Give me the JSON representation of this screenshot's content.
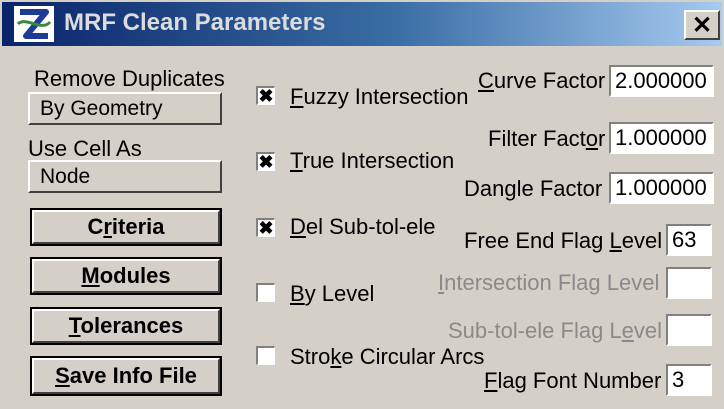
{
  "window": {
    "title": "MRF Clean Parameters",
    "close_label": "✕"
  },
  "left": {
    "remove_duplicates_label": "Remove Duplicates",
    "remove_duplicates_value": "By Geometry",
    "use_cell_label": "Use Cell As",
    "use_cell_value": "Node",
    "buttons": {
      "criteria": {
        "pre": "C",
        "ul": "r",
        "post": "iteria"
      },
      "modules": {
        "pre": "",
        "ul": "M",
        "post": "odules"
      },
      "tolerances": {
        "pre": "",
        "ul": "T",
        "post": "olerances"
      },
      "save_info": {
        "pre": "",
        "ul": "S",
        "post": "ave Info File"
      }
    }
  },
  "checkboxes": [
    {
      "pre": "",
      "ul": "F",
      "post": "uzzy Intersection",
      "checked": true,
      "mark": "✖"
    },
    {
      "pre": "",
      "ul": "T",
      "post": "rue Intersection",
      "checked": true,
      "mark": "✖"
    },
    {
      "pre": "",
      "ul": "D",
      "post": "el Sub-tol-ele",
      "checked": true,
      "mark": "✖"
    },
    {
      "pre": "",
      "ul": "B",
      "post": "y Level",
      "checked": false,
      "mark": ""
    },
    {
      "pre": "Stro",
      "ul": "k",
      "post": "e Circular Arcs",
      "checked": false,
      "mark": ""
    }
  ],
  "factors": {
    "curve": {
      "pre": "",
      "ul": "C",
      "post": "urve Factor",
      "value": "2.000000"
    },
    "filter": {
      "pre": "Filter Fact",
      "ul": "o",
      "post": "r",
      "value": "1.000000"
    },
    "dangle": {
      "pre": "Dan",
      "ul": "g",
      "post": "le Factor",
      "value": "1.000000"
    }
  },
  "flags": {
    "free_end": {
      "pre": "Free End Flag ",
      "ul": "L",
      "post": "evel",
      "value": "63"
    },
    "intersection": {
      "pre": "",
      "ul": "I",
      "post": "ntersection Flag Level",
      "value": ""
    },
    "subtol": {
      "pre": "Sub-tol-ele Flag L",
      "ul": "e",
      "post": "vel",
      "value": ""
    },
    "font": {
      "pre": "",
      "ul": "F",
      "post": "lag Font Number",
      "value": "3"
    }
  }
}
